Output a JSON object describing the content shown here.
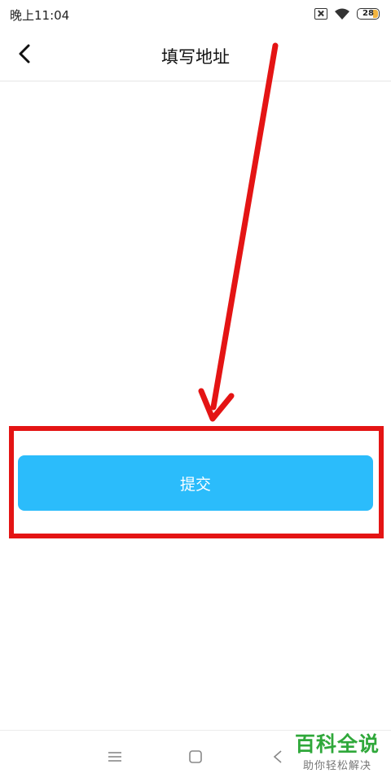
{
  "status_bar": {
    "time": "晚上11:04",
    "battery_level": "28",
    "icons": [
      "sim-off-icon",
      "wifi-icon",
      "battery-icon"
    ]
  },
  "header": {
    "title": "填写地址",
    "back_icon": "chevron-left-icon"
  },
  "form": {
    "submit_label": "提交"
  },
  "annotation": {
    "color": "#e41414"
  },
  "nav_bar": {
    "icons": [
      "menu-icon",
      "home-icon",
      "back-icon"
    ]
  },
  "watermark": {
    "title": "百科全说",
    "subtitle": "助你轻松解决"
  },
  "colors": {
    "primary": "#2bbcfb",
    "annotation": "#e41414",
    "watermark": "#2fa83a"
  }
}
